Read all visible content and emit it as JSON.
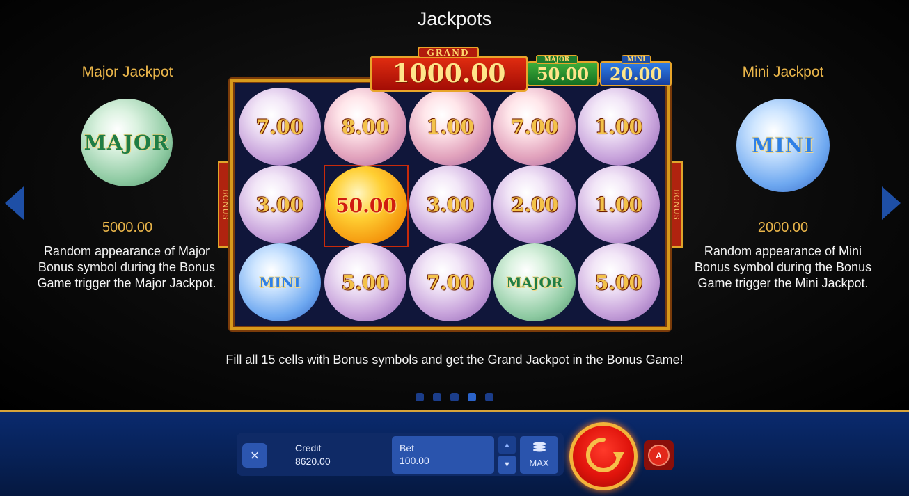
{
  "title": "Jackpots",
  "left_panel": {
    "heading": "Major Jackpot",
    "orb_label": "MAJOR",
    "amount": "5000.00",
    "description": "Random appearance of Major Bonus symbol during the Bonus Game trigger the Major Jackpot."
  },
  "right_panel": {
    "heading": "Mini Jackpot",
    "orb_label": "MINI",
    "amount": "2000.00",
    "description": "Random appearance of Mini Bonus symbol during the Bonus Game trigger the Mini Jackpot."
  },
  "jackpot_meters": {
    "grand_tag": "GRAND",
    "grand_value": "1000.00",
    "major_tag": "MAJOR",
    "major_value": "50.00",
    "mini_tag": "MINI",
    "mini_value": "20.00"
  },
  "side_tab_label": "BONUS",
  "grid": [
    [
      "7.00",
      "8.00",
      "1.00",
      "7.00",
      "1.00"
    ],
    [
      "3.00",
      "50.00",
      "3.00",
      "2.00",
      "1.00"
    ],
    [
      "MINI",
      "5.00",
      "7.00",
      "MAJOR",
      "5.00"
    ]
  ],
  "footer_text": "Fill all 15 cells with Bonus symbols and get the Grand Jackpot in the Bonus Game!",
  "pagination": {
    "total": 5,
    "active": 4
  },
  "bottom_bar": {
    "close_icon": "×",
    "credit_label": "Credit",
    "credit_value": "8620.00",
    "bet_label": "Bet",
    "bet_value": "100.00",
    "step_up_icon": "▲",
    "step_down_icon": "▼",
    "max_label": "MAX",
    "auto_label": "A"
  },
  "colors": {
    "accent_gold": "#e9b54a",
    "nav_blue": "#1e4fa6",
    "spin_red": "#e0140c"
  }
}
